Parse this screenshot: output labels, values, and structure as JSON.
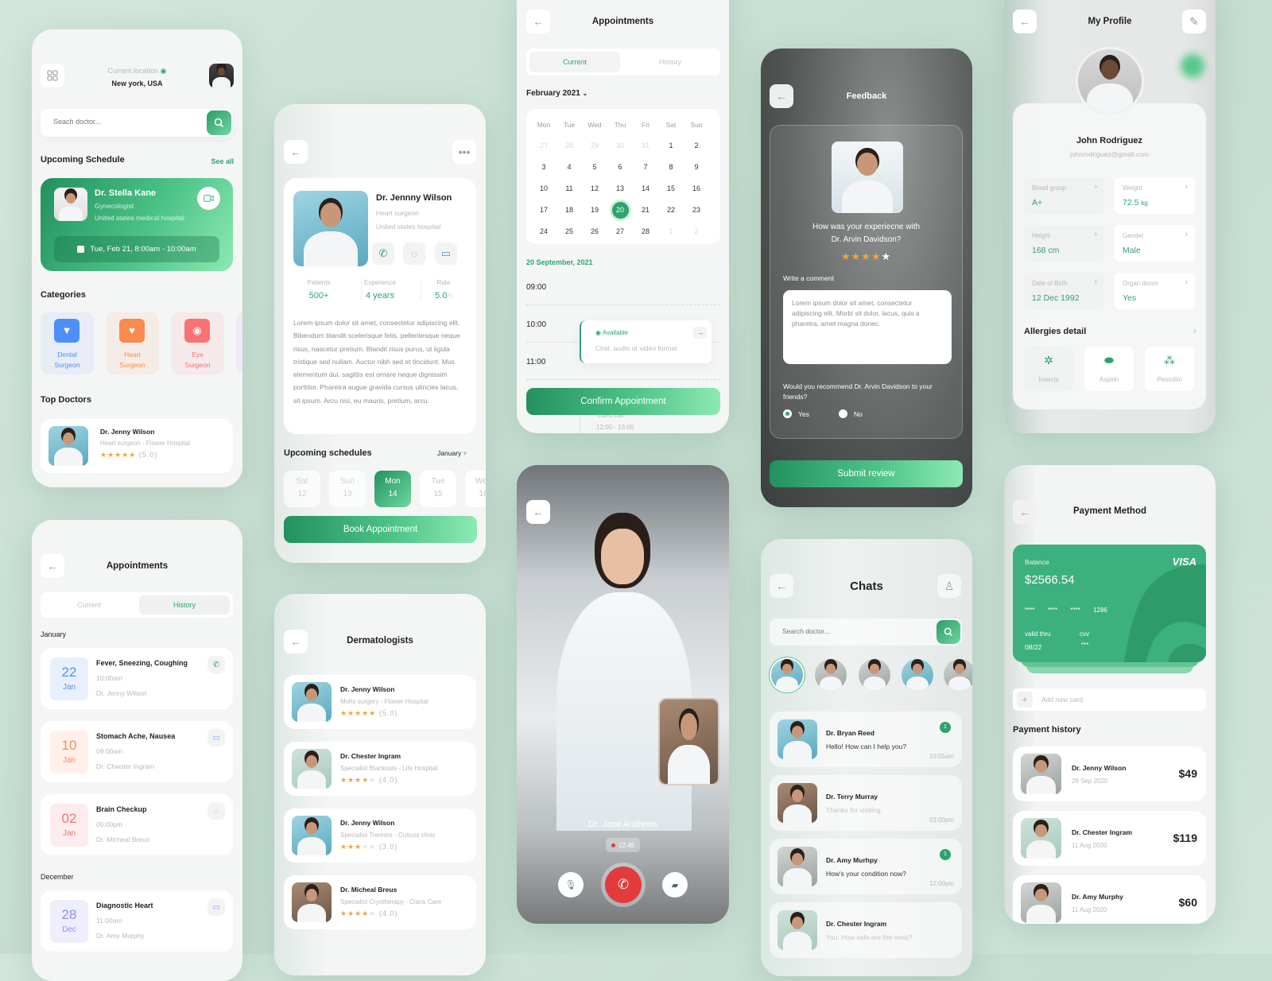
{
  "colors": {
    "primary": "#2fa36f",
    "primary_light": "#8ceab2",
    "danger": "#e23b3b",
    "star": "#f4a23c",
    "dental": "#4d8ff7",
    "heart": "#fb8a4e",
    "eye": "#f77373"
  },
  "home": {
    "menu_icon": "grid-icon",
    "location_label": "Current location",
    "location": "New york, USA",
    "search_placeholder": "Seach doctor...",
    "upcoming_title": "Upcoming Schedule",
    "see_all": "See all",
    "schedule": {
      "name": "Dr. Stella Kane",
      "specialty": "Gynecologist",
      "hospital": "United states medical hospital",
      "datetime": "Tue, Feb 21, 8:00am - 10:00am"
    },
    "categories_title": "Categories",
    "categories": [
      {
        "line1": "Dental",
        "line2": "Surgeon",
        "icon": "tooth-icon",
        "color": "#4d8ff7",
        "bg": "#e7ecf6"
      },
      {
        "line1": "Heart",
        "line2": "Surgeon",
        "icon": "heart-icon",
        "color": "#fb8a4e",
        "bg": "#f6ece7"
      },
      {
        "line1": "Eye",
        "line2": "Surgeon",
        "icon": "eye-icon",
        "color": "#f77373",
        "bg": "#f5e9ea"
      }
    ],
    "top_doctors_title": "Top Doctors",
    "top_doctor": {
      "name": "Dr. Jenny Wilson",
      "subtitle": "Heart surgeon - Flower Hospital",
      "rating": 5,
      "rating_label": "(5.0)"
    }
  },
  "doctor_detail": {
    "name": "Dr. Jennny Wilson",
    "specialty": "Heart surgeon",
    "hospital": "United states hospital",
    "stats": [
      {
        "label": "Patients",
        "value": "500+"
      },
      {
        "label": "Experience",
        "value": "4 years"
      },
      {
        "label": "Rate",
        "value": "5.0",
        "suffix": "/5"
      }
    ],
    "bio": "Lorem ipsum dolor sit amet, consectetur adipiscing elit. Bibendum blandit scelerisque felis, pellentesque neque risus, nascetur pretium. Blandit risus purus, ut ligula tristique sed nullam. Auctor nibh sed et tincidunt. Mus elementum dui, sagittis est ornare neque dignissim porttitor. Pharetra augue gravida cursus ultricies lacus, sit ipsum. Arcu nisi, eu mauris, pretium, arcu.",
    "upcoming_title": "Upcoming schedules",
    "month": "January",
    "days": [
      {
        "dow": "Sat",
        "day": "12"
      },
      {
        "dow": "Sun",
        "day": "13"
      },
      {
        "dow": "Mon",
        "day": "14",
        "selected": true
      },
      {
        "dow": "Tue",
        "day": "15"
      },
      {
        "dow": "Wed",
        "day": "16"
      }
    ],
    "book_label": "Book Appointment"
  },
  "appointments_calendar": {
    "title": "Appointments",
    "tabs": [
      {
        "label": "Current",
        "active": true
      },
      {
        "label": "History",
        "active": false
      }
    ],
    "month": "February 2021",
    "weekdays": [
      "Mon",
      "Tue",
      "Wed",
      "Thu",
      "Fri",
      "Sat",
      "Sun"
    ],
    "weeks": [
      [
        "27",
        "28",
        "29",
        "30",
        "31",
        "1",
        "2"
      ],
      [
        "3",
        "4",
        "5",
        "6",
        "7",
        "8",
        "9"
      ],
      [
        "10",
        "11",
        "12",
        "13",
        "14",
        "15",
        "16"
      ],
      [
        "17",
        "18",
        "19",
        "20",
        "21",
        "22",
        "23"
      ],
      [
        "24",
        "25",
        "26",
        "27",
        "28",
        "1",
        "2"
      ]
    ],
    "selected_day": "20",
    "date_label": "20 September, 2021",
    "times": [
      "09:00",
      "10:00",
      "11:00"
    ],
    "slot": {
      "status": "Available",
      "description": "Chat, audio or video format"
    },
    "hidden_slot": {
      "type": "Video call",
      "time": "12:00 - 13:00"
    },
    "confirm_label": "Confirm Appointment"
  },
  "feedback": {
    "title": "Feedback",
    "question": "How was your experiecne with",
    "doctor": "Dr. Arvin Davidson?",
    "rating": 4,
    "comment_label": "Write a comment",
    "comment": "Lorem ipsum dolor sit amet, consectetur adipiscing elit. Morbi sit dolor, lacus, quis a pharetra, amet magna donec.",
    "recommend_question": "Would you recommend Dr. Arvin Davidson to your friends?",
    "options": [
      {
        "label": "Yes",
        "selected": true
      },
      {
        "label": "No",
        "selected": false
      }
    ],
    "submit_label": "Submit review"
  },
  "profile": {
    "title": "My Profile",
    "name": "John Rodriguez",
    "email": "johnrodriguez@gmail.com",
    "fields": [
      {
        "label": "Blood group",
        "value": "A+"
      },
      {
        "label": "Weight",
        "value": "72.5",
        "unit": "kg"
      },
      {
        "label": "Height",
        "value": "168 cm"
      },
      {
        "label": "Gender",
        "value": "Male"
      },
      {
        "label": "Date of Birth",
        "value": "12 Dec 1992"
      },
      {
        "label": "Organ donor",
        "value": "Yes"
      }
    ],
    "allergies_title": "Allergies detail",
    "allergies": [
      {
        "label": "Insects",
        "icon": "bug-icon"
      },
      {
        "label": "Aspirin",
        "icon": "pill-icon"
      },
      {
        "label": "Penicillin",
        "icon": "tablets-icon"
      }
    ]
  },
  "appointments_history": {
    "title": "Appointments",
    "tabs": [
      {
        "label": "Current",
        "active": false
      },
      {
        "label": "History",
        "active": true
      }
    ],
    "groups": [
      {
        "month": "January",
        "items": [
          {
            "day": "22",
            "mon": "Jan",
            "title": "Fever, Sneezing, Coughing",
            "time": "10:00am",
            "doctor": "Dr. Jenny Wilson",
            "type": "phone-icon",
            "color": "#4d8ff7",
            "bg": "#e9f0fd"
          },
          {
            "day": "10",
            "mon": "Jan",
            "title": "Stomach Ache, Nausea",
            "time": "09:00am",
            "doctor": "Dr. Chwster Ingram",
            "type": "video-icon",
            "color": "#fb8a4e",
            "bg": "#fff1ea"
          },
          {
            "day": "02",
            "mon": "Jan",
            "title": "Brain Checkup",
            "time": "06:00pm",
            "doctor": "Dr. Micheal Breus",
            "type": "chat-icon",
            "color": "#f77373",
            "bg": "#fdeced"
          }
        ]
      },
      {
        "month": "December",
        "items": [
          {
            "day": "28",
            "mon": "Dec",
            "title": "Diagnostic Heart",
            "time": "11:00am",
            "doctor": "Dr. Amy Murphy",
            "type": "video-icon",
            "color": "#8b8ff0",
            "bg": "#eeeefd"
          }
        ]
      }
    ]
  },
  "dermatologists": {
    "title": "Dermatologists",
    "doctors": [
      {
        "name": "Dr. Jenny Wilson",
        "subtitle": "Mohs surgery - Flower Hospital",
        "rating": 5,
        "rating_label": "(5.0)"
      },
      {
        "name": "Dr. Chester Ingram",
        "subtitle": "Specialist Blackouts - Life Hospital",
        "rating": 4,
        "rating_label": "(4.0)"
      },
      {
        "name": "Dr. Jenny Wilson",
        "subtitle": "Specialist Tremors - Cuticos clinic",
        "rating": 3,
        "rating_label": "(3.0)"
      },
      {
        "name": "Dr. Micheal Breus",
        "subtitle": "Specialist Cryotherapy - Claris Care",
        "rating": 4,
        "rating_label": "(4.0)"
      }
    ]
  },
  "video_call": {
    "name": "Dr. Jane Andrews",
    "duration": "12:45"
  },
  "chats": {
    "title": "Chats",
    "search_placeholder": "Search doctor...",
    "conversations": [
      {
        "name": "Dr. Bryan Reed",
        "message": "Hello! How can I help you?",
        "time": "10:05am",
        "unread": "1"
      },
      {
        "name": "Dr. Terry Murray",
        "message": "Thanks for visiting.",
        "time": "03:00pm",
        "unread": ""
      },
      {
        "name": "Dr. Amy Murhpy",
        "message": "How's your condition now?",
        "time": "12:00pm",
        "unread": "1"
      },
      {
        "name": "Dr. Chester Ingram",
        "message": "You: How safe are the tests?",
        "time": "",
        "unread": ""
      }
    ]
  },
  "payment": {
    "title": "Payment Method",
    "card": {
      "balance_label": "Balance",
      "balance": "$2566.54",
      "brand": "VISA",
      "masked": [
        "****",
        "****",
        "****"
      ],
      "last4": "1286",
      "valid_label": "valid thru",
      "valid": "08/22",
      "cvv_label": "cvv",
      "cvv": "***"
    },
    "add_card": "Add new card",
    "history_title": "Payment history",
    "history": [
      {
        "name": "Dr. Jenny Wilson",
        "date": "28 Sep 2020",
        "amount": "$49"
      },
      {
        "name": "Dr. Chester Ingram",
        "date": "11 Aug 2020",
        "amount": "$119"
      },
      {
        "name": "Dr. Amy Murphy",
        "date": "11 Aug 2020",
        "amount": "$60"
      }
    ]
  }
}
